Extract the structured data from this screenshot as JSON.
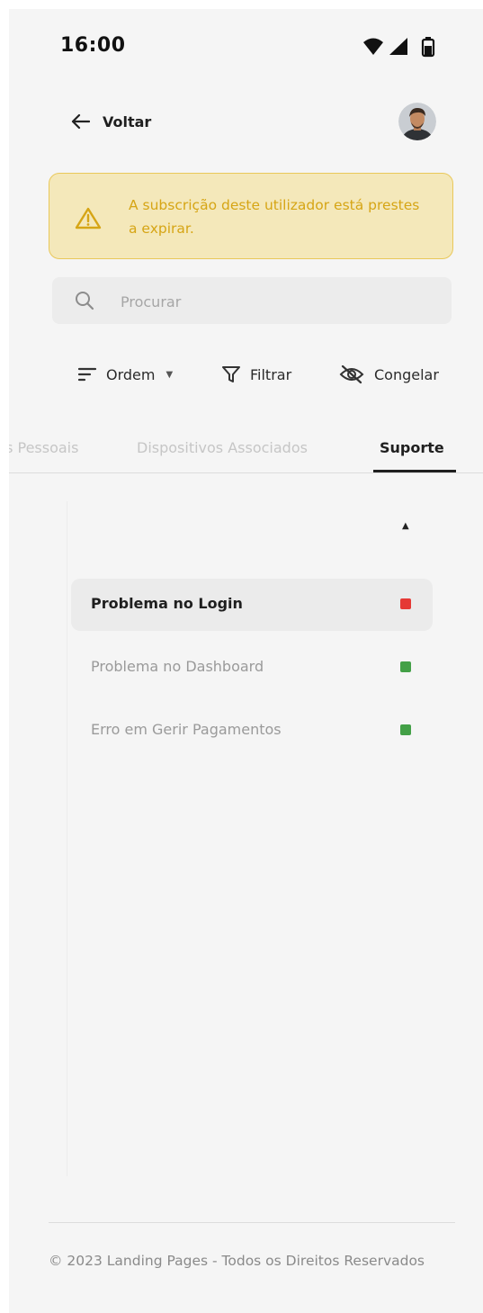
{
  "status_bar": {
    "time": "16:00"
  },
  "header": {
    "back_label": "Voltar"
  },
  "alert": {
    "message": "A subscrição deste utilizador está prestes a expirar.",
    "color": "#d6a515"
  },
  "search": {
    "placeholder": "Procurar",
    "value": ""
  },
  "toolbar": {
    "order_label": "Ordem",
    "filter_label": "Filtrar",
    "freeze_label": "Congelar"
  },
  "tabs": [
    {
      "label": "Dados Pessoais",
      "active": false
    },
    {
      "label": "Dispositivos Associados",
      "active": false
    },
    {
      "label": "Suporte",
      "active": true
    }
  ],
  "tickets": [
    {
      "title": "Problema no Login",
      "status_color": "#e53935",
      "selected": true
    },
    {
      "title": "Problema no Dashboard",
      "status_color": "#43a047",
      "selected": false
    },
    {
      "title": "Erro em Gerir Pagamentos",
      "status_color": "#43a047",
      "selected": false
    }
  ],
  "footer": {
    "text": "© 2023 Landing Pages - Todos os Direitos Reservados"
  }
}
